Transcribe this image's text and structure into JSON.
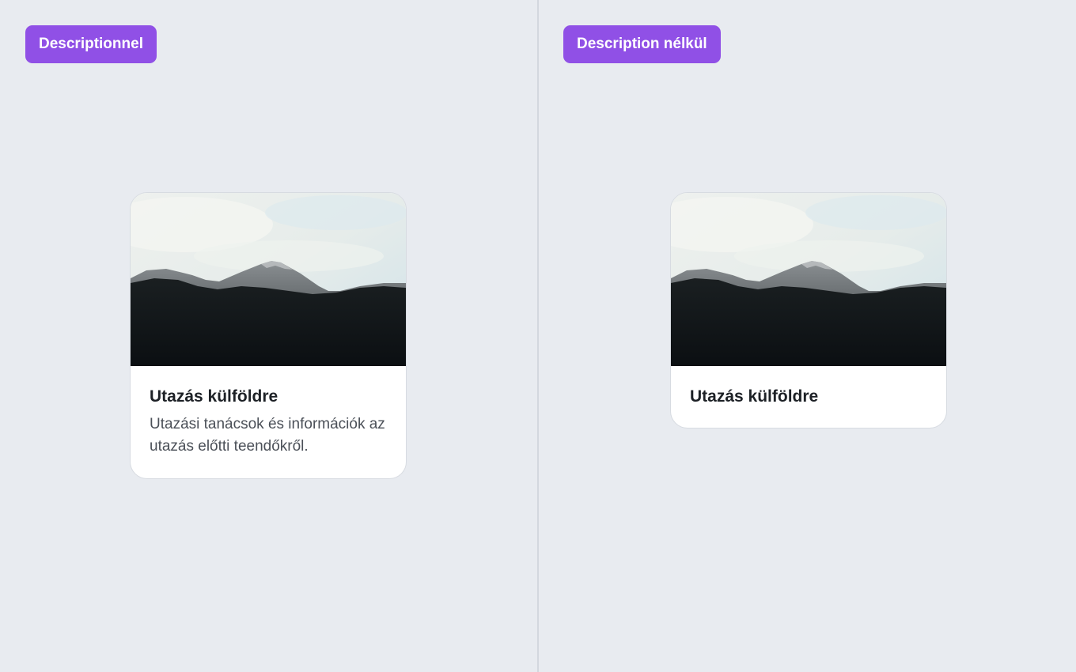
{
  "left_panel": {
    "badge_label": "Descriptionnel",
    "card": {
      "image_alt": "mountain-landscape",
      "title": "Utazás külföldre",
      "description": "Utazási tanácsok és információk az utazás előtti teendőkről."
    }
  },
  "right_panel": {
    "badge_label": "Description nélkül",
    "card": {
      "image_alt": "mountain-landscape",
      "title": "Utazás külföldre"
    }
  },
  "colors": {
    "background": "#e8ebf0",
    "badge": "#9050e6",
    "card_bg": "#ffffff",
    "title": "#1d2126",
    "description": "#4b5058"
  }
}
